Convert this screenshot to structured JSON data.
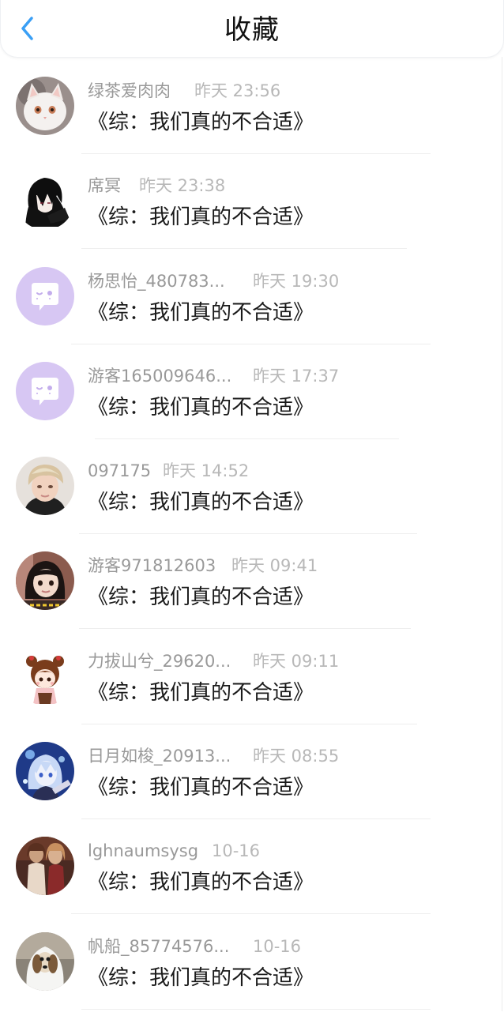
{
  "header": {
    "title": "收藏",
    "back_icon": "chevron-left-icon",
    "accent_color": "#3a9ff5"
  },
  "items": [
    {
      "user": "绿茶爱肉肉",
      "time": "昨天 23:56",
      "book": "《综：我们真的不合适》",
      "avatar": "white-cat"
    },
    {
      "user": "席冥",
      "time": "昨天 23:38",
      "book": "《综：我们真的不合适》",
      "avatar": "anime-dark-hair"
    },
    {
      "user": "杨思怡_480783...",
      "time": "昨天 19:30",
      "book": "《综：我们真的不合适》",
      "avatar": "default-chat-bubble"
    },
    {
      "user": "游客165009646...",
      "time": "昨天 17:37",
      "book": "《综：我们真的不合适》",
      "avatar": "default-chat-bubble"
    },
    {
      "user": "097175",
      "time": "昨天 14:52",
      "book": "《综：我们真的不合适》",
      "avatar": "blond-person"
    },
    {
      "user": "游客971812603",
      "time": "昨天 09:41",
      "book": "《综：我们真的不合适》",
      "avatar": "girl-photo"
    },
    {
      "user": "力拔山兮_29620...",
      "time": "昨天 09:11",
      "book": "《综：我们真的不合适》",
      "avatar": "chibi-girl"
    },
    {
      "user": "日月如梭_20913...",
      "time": "昨天 08:55",
      "book": "《综：我们真的不合适》",
      "avatar": "blue-anime"
    },
    {
      "user": "lghnaumsysg",
      "time": "10-16",
      "book": "《综：我们真的不合适》",
      "avatar": "two-women"
    },
    {
      "user": "帆船_85774576...",
      "time": "10-16",
      "book": "《综：我们真的不合适》",
      "avatar": "ghost-dog"
    }
  ]
}
